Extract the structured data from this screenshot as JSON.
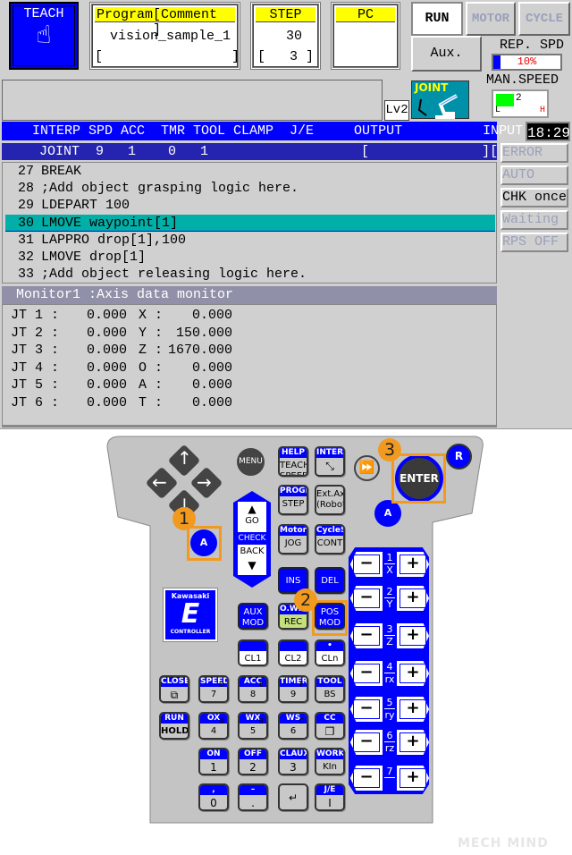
{
  "top": {
    "mode": "TEACH",
    "program_header": "Program",
    "comment_header": "[Comment ]",
    "program_name": "vision_sample_1",
    "comment_value": "[                ]",
    "step_header": "STEP",
    "step_value": "30",
    "step_sub": "[   3 ]",
    "pc_header": "PC",
    "run": "RUN",
    "motor": "MOTOR",
    "cycle": "CYCLE",
    "aux": "Aux.",
    "rep_spd_label": "REP. SPD",
    "rep_spd_value": "10%",
    "rep_spd_percent": 10,
    "man_speed_label": "MAN.SPEED",
    "man_speed_value": "2",
    "man_speed_low": "L",
    "man_speed_high": "H",
    "level": "Lv2",
    "coord_mode": "JOINT",
    "clock": "18:29"
  },
  "status_header": {
    "columns": "INTERP SPD ACC  TMR TOOL CLAMP  J/E     OUTPUT          INPUT",
    "values": "JOINT  9   1    0   1                   [              ][                ]"
  },
  "status_buttons": [
    "ERROR",
    "AUTO",
    "CHK once",
    "Waiting",
    "RPS OFF"
  ],
  "program_lines": [
    {
      "num": "27",
      "text": "BREAK"
    },
    {
      "num": "28",
      "text": ";Add object grasping logic here."
    },
    {
      "num": "29",
      "text": "LDEPART 100"
    },
    {
      "num": "30",
      "text": "LMOVE waypoint[1]",
      "selected": true
    },
    {
      "num": "31",
      "text": "LAPPRO drop[1],100"
    },
    {
      "num": "32",
      "text": "LMOVE drop[1]"
    },
    {
      "num": "33",
      "text": ";Add object releasing logic here."
    }
  ],
  "monitor": {
    "title": "Monitor1 :Axis data monitor",
    "rows": [
      {
        "jt": "JT 1 :",
        "jv": "0.000",
        "ax": "X :",
        "av": "0.000"
      },
      {
        "jt": "JT 2 :",
        "jv": "0.000",
        "ax": "Y :",
        "av": "150.000"
      },
      {
        "jt": "JT 3 :",
        "jv": "0.000",
        "ax": "Z :",
        "av": "1670.000"
      },
      {
        "jt": "JT 4 :",
        "jv": "0.000",
        "ax": "O :",
        "av": "0.000"
      },
      {
        "jt": "JT 5 :",
        "jv": "0.000",
        "ax": "A :",
        "av": "0.000"
      },
      {
        "jt": "JT 6 :",
        "jv": "0.000",
        "ax": "T :",
        "av": "0.000"
      }
    ]
  },
  "pendant": {
    "menu": "MENU",
    "enter": "ENTER",
    "r": "R",
    "a": "A",
    "go": "GO",
    "check": "CHECK",
    "back": "BACK",
    "logo_brand": "Kawasaki",
    "logo_sub": "CONTROLLER",
    "badges": [
      "1",
      "2",
      "3"
    ],
    "keys": [
      {
        "top": "HELP",
        "main": "TEACH\nSPEED"
      },
      {
        "top": "INTERP",
        "main": "⤡"
      },
      {
        "top": "PROGRAM",
        "main": "STEP"
      },
      {
        "top": "",
        "main": "Ext.Axis\n(Robot)"
      },
      {
        "top": "MotorON",
        "main": "JOG"
      },
      {
        "top": "CycleStart",
        "main": "CONT"
      },
      {
        "top": "",
        "main": "INS"
      },
      {
        "top": "",
        "main": "DEL"
      },
      {
        "top": "",
        "main": "AUX\nMOD"
      },
      {
        "top": "O.WRITE",
        "main": "REC"
      },
      {
        "top": "",
        "main": "POS\nMOD"
      },
      {
        "top": "",
        "main": "CL1"
      },
      {
        "top": "",
        "main": "CL2"
      },
      {
        "top": "•",
        "main": "CLn"
      },
      {
        "top": "CLOSE",
        "main": "⧉"
      },
      {
        "top": "SPEED",
        "main": "7",
        "sub": "D"
      },
      {
        "top": "ACC",
        "main": "8",
        "sub": "E"
      },
      {
        "top": "TIMER",
        "main": "9",
        "sub": "F"
      },
      {
        "top": "TOOL",
        "main": "BS"
      },
      {
        "top": "RUN",
        "main": "HOLD"
      },
      {
        "top": "OX",
        "main": "4",
        "sub": "A"
      },
      {
        "top": "WX",
        "main": "5",
        "sub": "B"
      },
      {
        "top": "WS",
        "main": "6",
        "sub": "C"
      },
      {
        "top": "CC",
        "main": "❐"
      },
      {
        "top": "ON",
        "main": "1"
      },
      {
        "top": "OFF",
        "main": "2"
      },
      {
        "top": "CLAUX",
        "main": "3"
      },
      {
        "top": "WORK",
        "main": "KIn"
      },
      {
        "top": ",",
        "main": "0"
      },
      {
        "top": "–",
        "main": "."
      },
      {
        "top": "",
        "main": "↵"
      },
      {
        "top": "J/E",
        "main": "I"
      }
    ],
    "jog": {
      "minus": "−",
      "plus": "+",
      "rows": [
        {
          "num": "1",
          "axis": "X"
        },
        {
          "num": "2",
          "axis": "Y"
        },
        {
          "num": "3",
          "axis": "Z"
        },
        {
          "num": "4",
          "axis": "rx"
        },
        {
          "num": "5",
          "axis": "ry"
        },
        {
          "num": "6",
          "axis": "rz"
        },
        {
          "num": "7",
          "axis": ""
        }
      ]
    }
  },
  "watermark": "MECH MIND",
  "colors": {
    "teach": "#0000ff",
    "header_yellow": "#ffff00",
    "selected_line": "#00b0a8",
    "status_bar": "#0000ff",
    "monitor_header": "#9090a8",
    "badge": "#f29a1f"
  }
}
